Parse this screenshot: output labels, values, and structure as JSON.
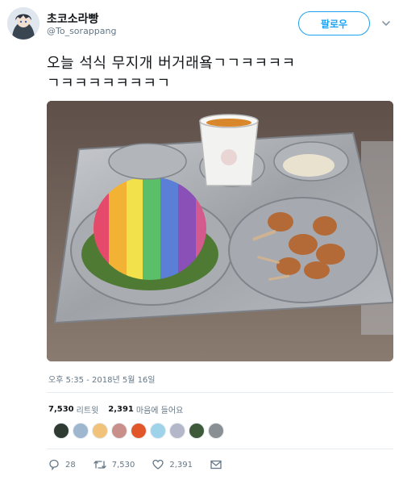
{
  "user": {
    "display_name": "초코소라빵",
    "handle": "@To_sorappang",
    "avatar_icon": "avatar-illustration"
  },
  "follow_button": {
    "label": "팔로우"
  },
  "tweet": {
    "text_line1": "오늘 석식 무지개 버거래욬ㄱㄱㅋㅋㅋㅋ",
    "text_line2": "ㄱㅋㅋㅋㅋㅋㅋㅋㄱ",
    "photo_icon": "school-lunch-tray-rainbow-burger-photo",
    "timestamp": "오후 5:35 - 2018년 5월 16일"
  },
  "stats": {
    "retweets_count": "7,530",
    "retweets_label": "리트윗",
    "likes_count": "2,391",
    "likes_label": "마음에 들어요"
  },
  "likers_count_shown": 9,
  "actions": {
    "reply_count": "28",
    "retweet_count": "7,530",
    "like_count": "2,391"
  },
  "colors": {
    "accent": "#1da1f2",
    "secondary_text": "#657786",
    "divider": "#e6ecf0"
  }
}
